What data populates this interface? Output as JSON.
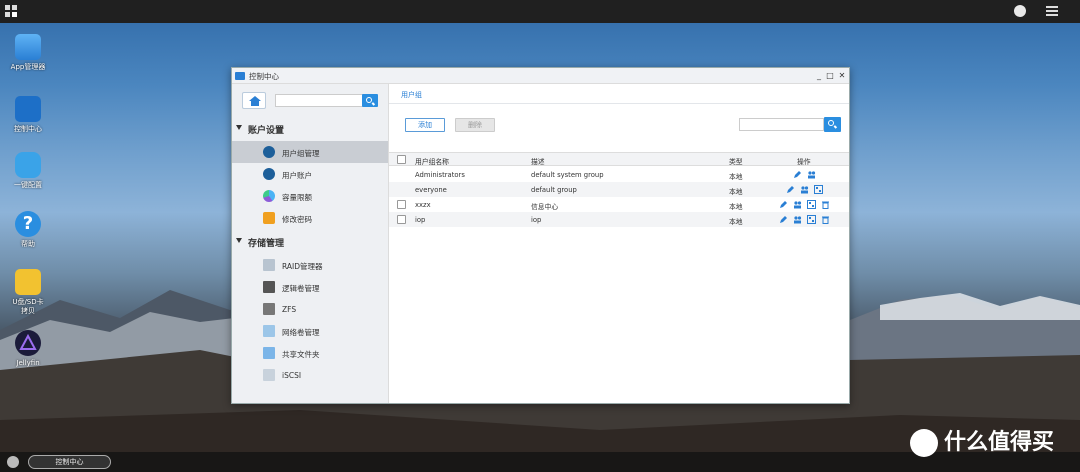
{
  "desktop": {
    "icons": [
      {
        "label": "App管理器",
        "icon": "app-store-icon"
      },
      {
        "label": "控制中心",
        "icon": "control-center-icon"
      },
      {
        "label": "一键配置",
        "icon": "mouse-icon"
      },
      {
        "label": "帮助",
        "icon": "help-icon"
      },
      {
        "label": "U盘/SD卡\n拷贝",
        "icon": "folder-icon"
      },
      {
        "label": "Jellyfin",
        "icon": "jellyfin-icon"
      }
    ]
  },
  "window": {
    "title": "控制中心",
    "controls": {
      "minimize": "_",
      "maximize": "□",
      "close": "✕"
    }
  },
  "sidebar": {
    "sections": [
      {
        "title": "账户设置",
        "items": [
          {
            "label": "用户组管理",
            "icon": "user-group-icon",
            "active": true
          },
          {
            "label": "用户账户",
            "icon": "user-icon",
            "active": false
          },
          {
            "label": "容量限额",
            "icon": "quota-icon",
            "active": false
          },
          {
            "label": "修改密码",
            "icon": "lock-icon",
            "active": false
          }
        ]
      },
      {
        "title": "存储管理",
        "items": [
          {
            "label": "RAID管理器",
            "icon": "raid-icon",
            "active": false
          },
          {
            "label": "逻辑卷管理",
            "icon": "logical-volume-icon",
            "active": false
          },
          {
            "label": "ZFS",
            "icon": "zfs-icon",
            "active": false
          },
          {
            "label": "网络卷管理",
            "icon": "network-volume-icon",
            "active": false
          },
          {
            "label": "共享文件夹",
            "icon": "shared-folder-icon",
            "active": false
          },
          {
            "label": "iSCSI",
            "icon": "iscsi-icon",
            "active": false
          }
        ]
      }
    ]
  },
  "content": {
    "breadcrumb": "用户组",
    "add_label": "添加",
    "delete_label": "删除",
    "table": {
      "headers": [
        "用户组名称",
        "描述",
        "类型",
        "操作"
      ],
      "rows": [
        {
          "name": "Administrators",
          "desc": "default system group",
          "type": "本地",
          "actions": [
            "edit",
            "members"
          ],
          "checkbox": false
        },
        {
          "name": "everyone",
          "desc": "default group",
          "type": "本地",
          "actions": [
            "edit",
            "members",
            "permissions"
          ],
          "checkbox": false
        },
        {
          "name": "xxzx",
          "desc": "信息中心",
          "type": "本地",
          "actions": [
            "edit",
            "members",
            "permissions",
            "delete"
          ],
          "checkbox": true
        },
        {
          "name": "iop",
          "desc": "iop",
          "type": "本地",
          "actions": [
            "edit",
            "members",
            "permissions",
            "delete"
          ],
          "checkbox": true
        }
      ]
    }
  },
  "taskbar": {
    "active_app": "控制中心"
  },
  "watermark": "什么值得买",
  "colors": {
    "accent": "#2a8ee0",
    "topbar": "#202020"
  }
}
